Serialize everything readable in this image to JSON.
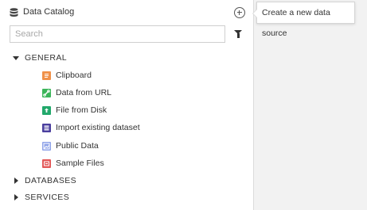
{
  "catalog": {
    "title": "Data Catalog",
    "search_placeholder": "Search",
    "search_value": "",
    "icons": {
      "title": "database-icon",
      "add": "plus-circle-icon",
      "filter": "filter-icon"
    }
  },
  "tooltip": {
    "text": "Create a new data source"
  },
  "groups": {
    "general": {
      "label": "GENERAL",
      "expanded": true,
      "items": [
        {
          "label": "Clipboard",
          "icon": "clipboard-icon",
          "color": "#f0914a"
        },
        {
          "label": "Data from URL",
          "icon": "link-icon",
          "color": "#3cb55a"
        },
        {
          "label": "File from Disk",
          "icon": "file-upload-icon",
          "color": "#22a86b"
        },
        {
          "label": "Import existing dataset",
          "icon": "dataset-icon",
          "color": "#4b3f9e"
        },
        {
          "label": "Public Data",
          "icon": "public-data-icon",
          "color": "#8fa3e8"
        },
        {
          "label": "Sample Files",
          "icon": "sample-files-icon",
          "color": "#e35a5a"
        }
      ]
    },
    "databases": {
      "label": "DATABASES",
      "expanded": false
    },
    "services": {
      "label": "SERVICES",
      "expanded": false
    }
  }
}
